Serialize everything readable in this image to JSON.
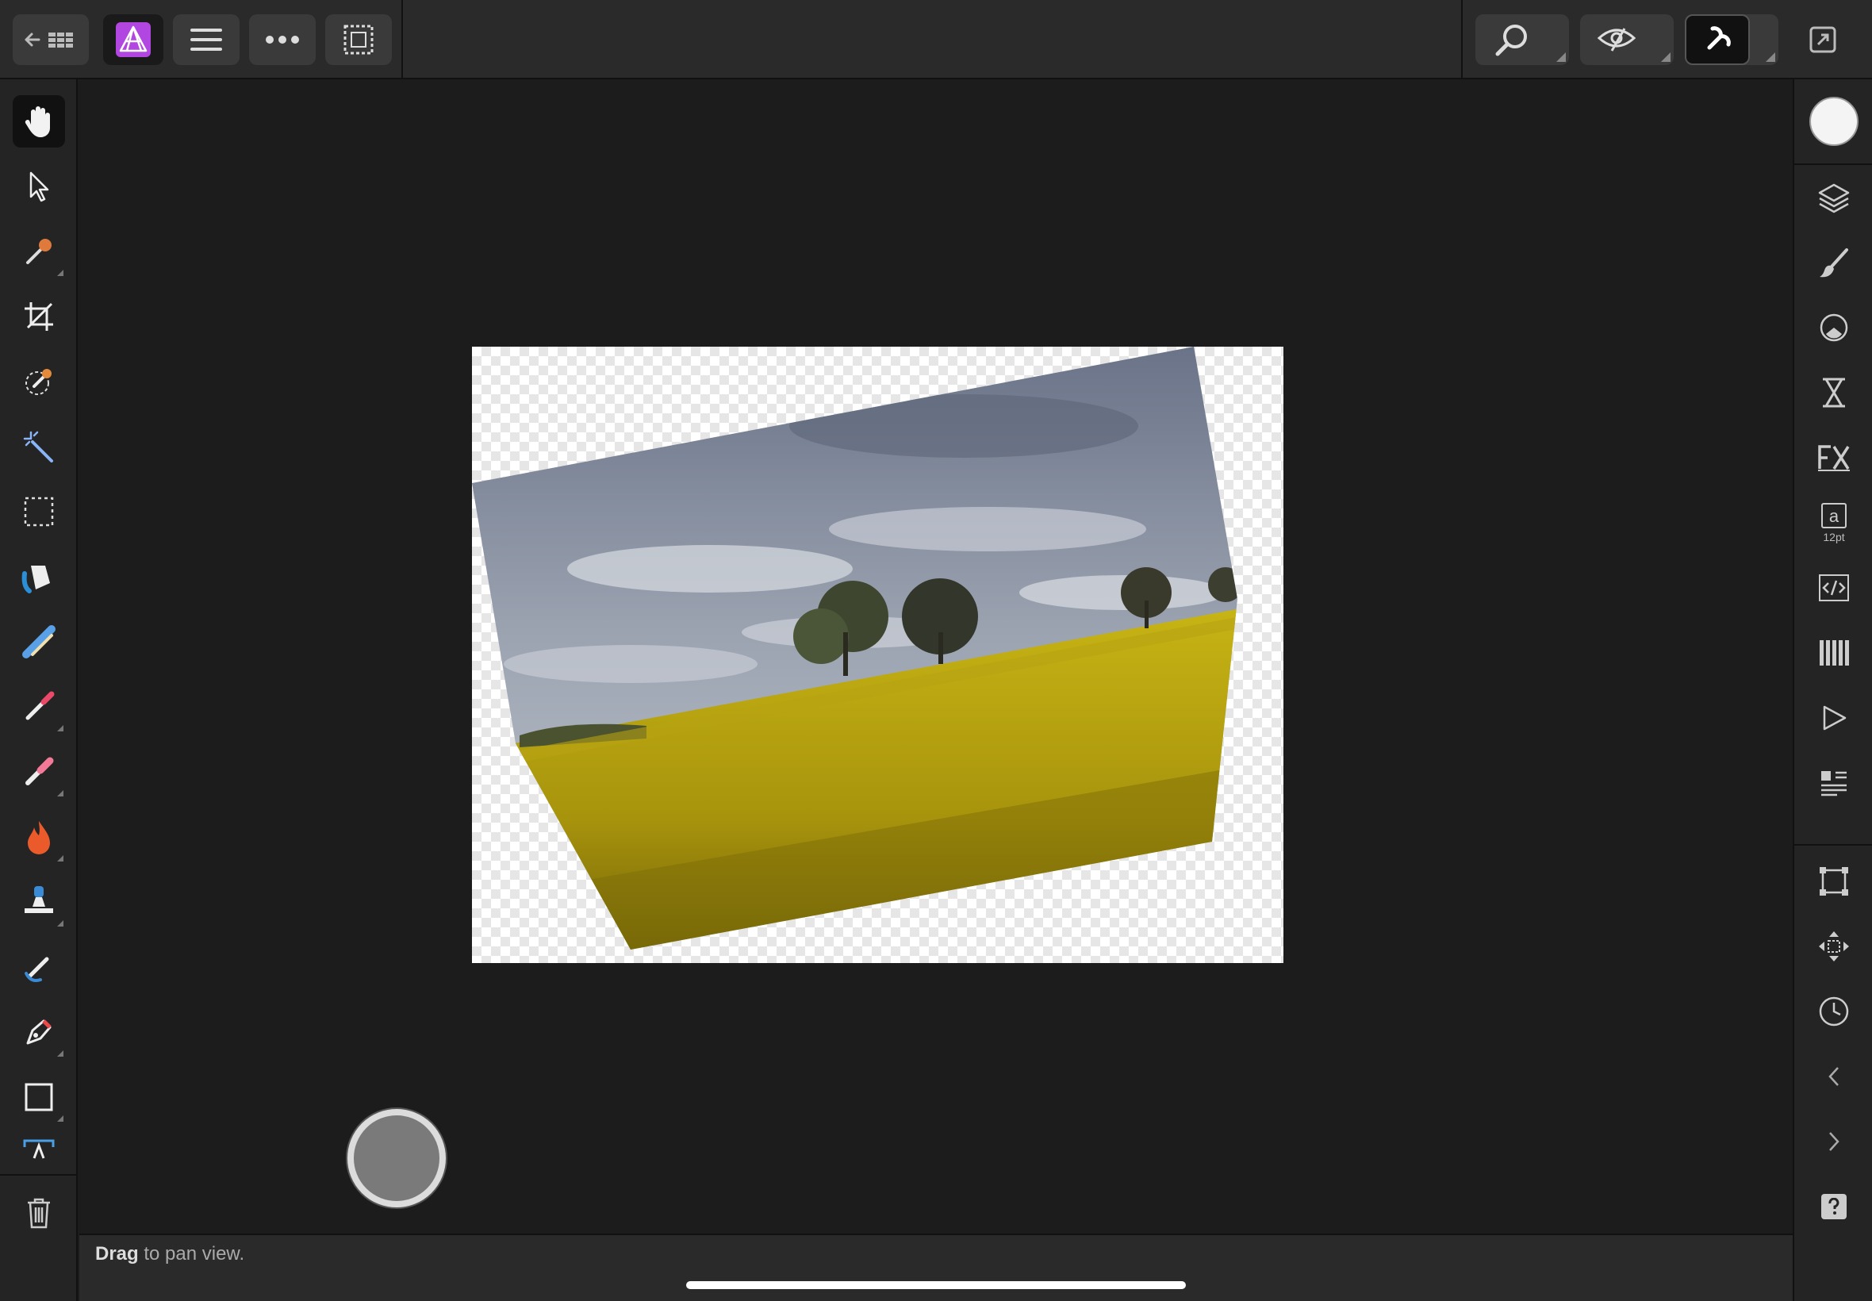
{
  "status": {
    "bold": "Drag",
    "rest": " to pan view."
  },
  "panels": {
    "text_size": "12pt"
  },
  "colors": {
    "accent": "#b146e0",
    "canvas": "#1c1c1c",
    "panel": "#2a2a2a",
    "field": "#c8b512",
    "sky": "#8a94a6"
  },
  "icons": {
    "top": [
      "back-grid-icon",
      "affinity-photo-logo",
      "menu-icon",
      "more-icon",
      "selection-icon",
      "zoom-icon",
      "view-icon",
      "snapping-icon",
      "fullscreen-icon"
    ],
    "tools": [
      "hand-icon",
      "move-icon",
      "color-picker-icon",
      "crop-icon",
      "selection-brush-icon",
      "flood-select-icon",
      "marquee-icon",
      "fill-icon",
      "gradient-icon",
      "paint-brush-icon",
      "erase-brush-icon",
      "dodge-burn-icon",
      "clone-icon",
      "smudge-icon",
      "pen-icon",
      "rectangle-icon",
      "text-icon",
      "trash-icon"
    ],
    "panels": [
      "color-icon",
      "layers-icon",
      "brushes-icon",
      "adjustments-icon",
      "history-icon",
      "fx-icon",
      "text-style-icon",
      "code-icon",
      "channels-icon",
      "play-icon",
      "navigator-icon",
      "transform-icon",
      "move-view-icon",
      "clock-icon",
      "prev-icon",
      "next-icon",
      "help-icon"
    ]
  }
}
